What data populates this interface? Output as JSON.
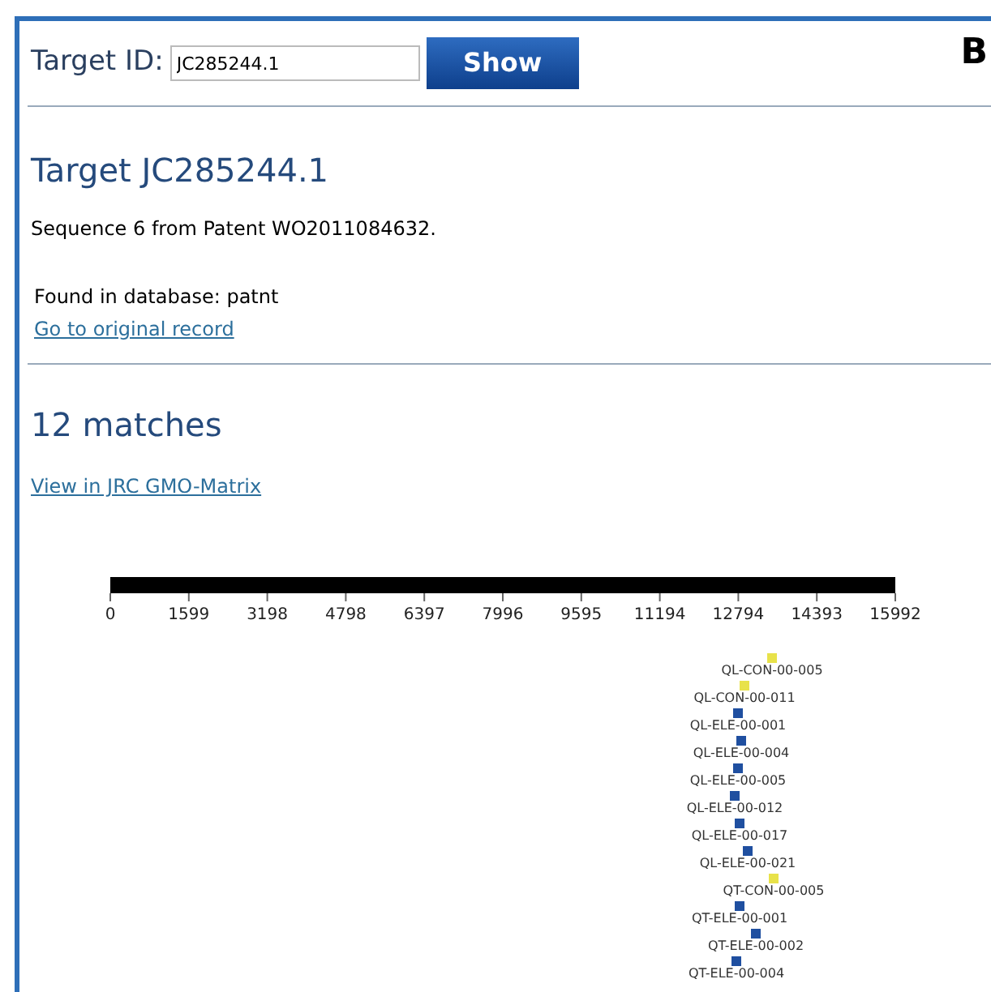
{
  "panel_letter": "B",
  "search": {
    "label": "Target ID:",
    "value": "JC285244.1",
    "button": "Show"
  },
  "target": {
    "title": "Target JC285244.1",
    "description": "Sequence 6 from Patent WO2011084632.",
    "database": "Found in database: patnt",
    "link": "Go to original record"
  },
  "matches": {
    "title": "12 matches",
    "link": "View in JRC GMO-Matrix",
    "scale_ticks": [
      "0",
      "1599",
      "3198",
      "4798",
      "6397",
      "7996",
      "9595",
      "11194",
      "12794",
      "14393",
      "15992"
    ],
    "items": [
      {
        "name": "QL-CON-00-005",
        "color": "#e8e24a"
      },
      {
        "name": "QL-CON-00-011",
        "color": "#e8e24a"
      },
      {
        "name": "QL-ELE-00-001",
        "color": "#1f4fa0"
      },
      {
        "name": "QL-ELE-00-004",
        "color": "#1f4fa0"
      },
      {
        "name": "QL-ELE-00-005",
        "color": "#1f4fa0"
      },
      {
        "name": "QL-ELE-00-012",
        "color": "#1f4fa0"
      },
      {
        "name": "QL-ELE-00-017",
        "color": "#1f4fa0"
      },
      {
        "name": "QL-ELE-00-021",
        "color": "#1f4fa0"
      },
      {
        "name": "QT-CON-00-005",
        "color": "#e8e24a"
      },
      {
        "name": "QT-ELE-00-001",
        "color": "#1f4fa0"
      },
      {
        "name": "QT-ELE-00-002",
        "color": "#1f4fa0"
      },
      {
        "name": "QT-ELE-00-004",
        "color": "#1f4fa0"
      }
    ]
  }
}
